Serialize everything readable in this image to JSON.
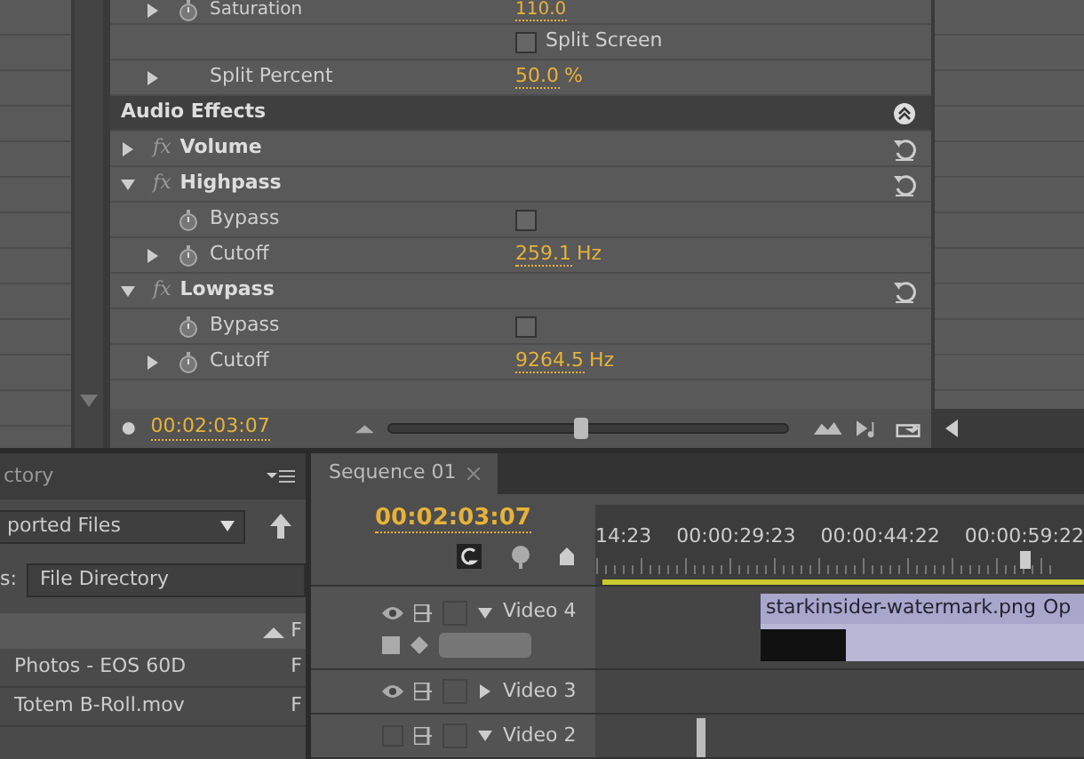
{
  "effect_controls": {
    "rows": [
      {
        "kind": "param",
        "label": "Saturation",
        "value": "110.0",
        "expanded": false,
        "stopwatch": true
      },
      {
        "kind": "checkbox",
        "label": "Split Screen",
        "checked": false
      },
      {
        "kind": "param",
        "label": "Split Percent",
        "value": "50.0 %",
        "expanded": false,
        "stopwatch": false
      },
      {
        "kind": "section",
        "label": "Audio Effects"
      },
      {
        "kind": "effect",
        "badge": "fx",
        "label": "Volume",
        "expanded": false
      },
      {
        "kind": "effect",
        "badge": "fx",
        "label": "Highpass",
        "expanded": true
      },
      {
        "kind": "toggle",
        "label": "Bypass",
        "checked": false
      },
      {
        "kind": "param",
        "label": "Cutoff",
        "value": "259.1 Hz",
        "expanded": false,
        "stopwatch": true
      },
      {
        "kind": "effect",
        "badge": "fx",
        "label": "Lowpass",
        "expanded": true
      },
      {
        "kind": "toggle",
        "label": "Bypass",
        "checked": false
      },
      {
        "kind": "param",
        "label": "Cutoff",
        "value": "9264.5 Hz",
        "expanded": false,
        "stopwatch": true
      }
    ],
    "footer": {
      "timecode": "00:02:03:07",
      "zoom": {
        "level": 0.48
      }
    }
  },
  "project": {
    "tab": "ctory",
    "filter": "ported Files",
    "view_label": "s:",
    "view_value": "File Directory",
    "header_column": "F",
    "files": [
      {
        "name": "Photos - EOS 60D",
        "type": "F"
      },
      {
        "name": "Totem B-Roll.mov",
        "type": "F"
      }
    ]
  },
  "timeline": {
    "tab": "Sequence 01",
    "timecode": "00:02:03:07",
    "ruler": [
      "14:23",
      "00:00:29:23",
      "00:00:44:22",
      "00:00:59:22"
    ],
    "playhead": {
      "level": 0.88
    },
    "tracks": [
      {
        "name": "Video 4",
        "visible": true,
        "expanded": true,
        "clip": {
          "name": "starkinsider-watermark.png",
          "label_2": "Op"
        }
      },
      {
        "name": "Video 3",
        "visible": true,
        "expanded": false
      },
      {
        "name": "Video 2",
        "visible": false,
        "expanded": true
      }
    ]
  }
}
